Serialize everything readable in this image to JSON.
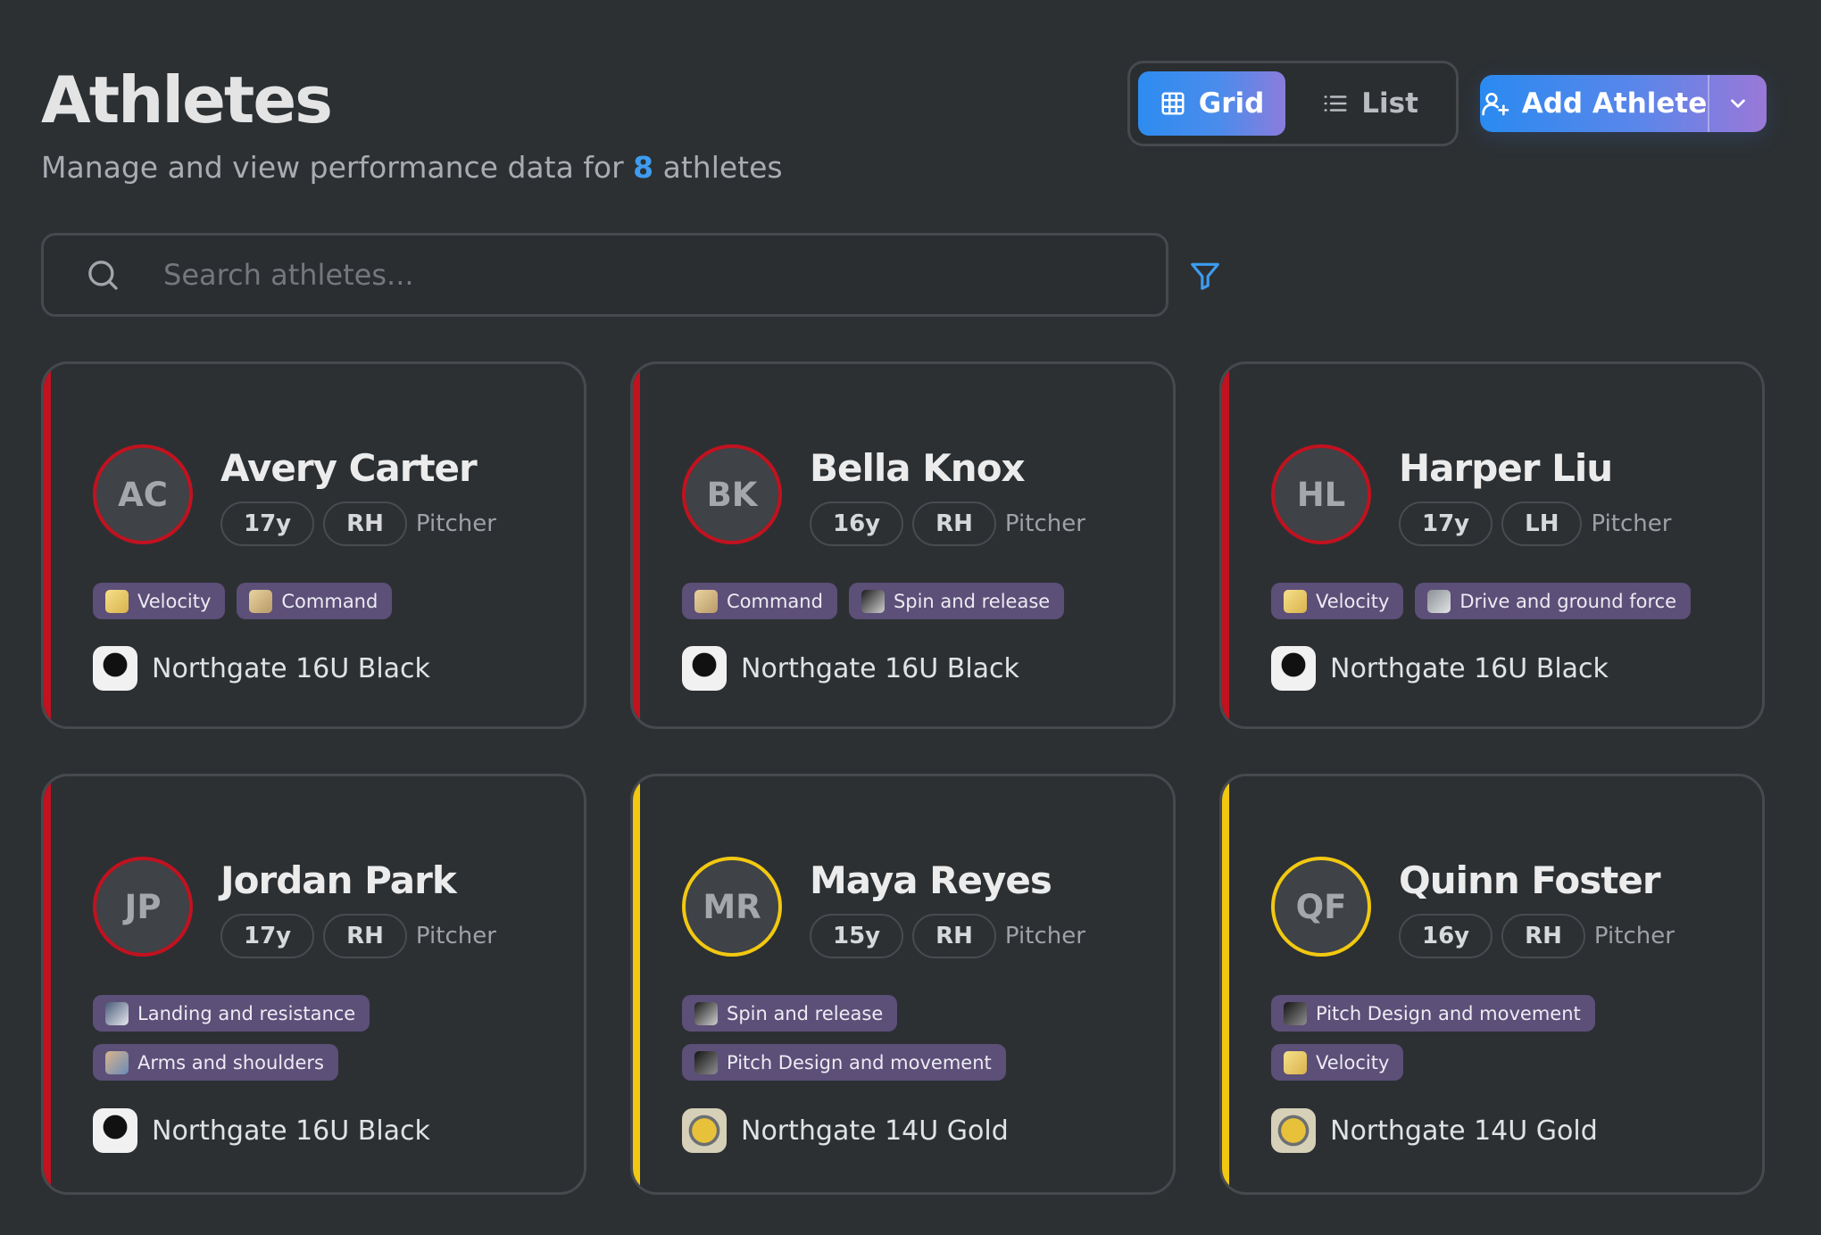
{
  "header": {
    "title": "Athletes",
    "subtitle_prefix": "Manage and view performance data for",
    "count": "8",
    "subtitle_suffix": "athletes"
  },
  "view_toggle": {
    "grid_label": "Grid",
    "list_label": "List",
    "active": "Grid"
  },
  "add_button": {
    "label": "Add Athlete"
  },
  "search": {
    "placeholder": "Search athletes...",
    "value": ""
  },
  "colors": {
    "accent_blue": "#2d8cf0",
    "accent_purple": "#9a78d8",
    "team_16u_black": "#c1121f",
    "team_14u_gold": "#f2c811",
    "tag_bg": "#5c4f78"
  },
  "athletes": [
    {
      "initials": "AC",
      "name": "Avery Carter",
      "age": "17y",
      "hand": "RH",
      "position": "Pitcher",
      "tags": [
        "Velocity",
        "Command"
      ],
      "team": "Northgate 16U Black",
      "team_color": "#c1121f"
    },
    {
      "initials": "BK",
      "name": "Bella Knox",
      "age": "16y",
      "hand": "RH",
      "position": "Pitcher",
      "tags": [
        "Command",
        "Spin and release"
      ],
      "team": "Northgate 16U Black",
      "team_color": "#c1121f"
    },
    {
      "initials": "HL",
      "name": "Harper Liu",
      "age": "17y",
      "hand": "LH",
      "position": "Pitcher",
      "tags": [
        "Velocity",
        "Drive and ground force"
      ],
      "team": "Northgate 16U Black",
      "team_color": "#c1121f"
    },
    {
      "initials": "JP",
      "name": "Jordan Park",
      "age": "17y",
      "hand": "RH",
      "position": "Pitcher",
      "tags": [
        "Landing and resistance",
        "Arms and shoulders"
      ],
      "team": "Northgate 16U Black",
      "team_color": "#c1121f"
    },
    {
      "initials": "MR",
      "name": "Maya Reyes",
      "age": "15y",
      "hand": "RH",
      "position": "Pitcher",
      "tags": [
        "Spin and release",
        "Pitch Design and movement"
      ],
      "team": "Northgate 14U Gold",
      "team_color": "#f2c811"
    },
    {
      "initials": "QF",
      "name": "Quinn Foster",
      "age": "16y",
      "hand": "RH",
      "position": "Pitcher",
      "tags": [
        "Pitch Design and movement",
        "Velocity"
      ],
      "team": "Northgate 14U Gold",
      "team_color": "#f2c811"
    }
  ]
}
